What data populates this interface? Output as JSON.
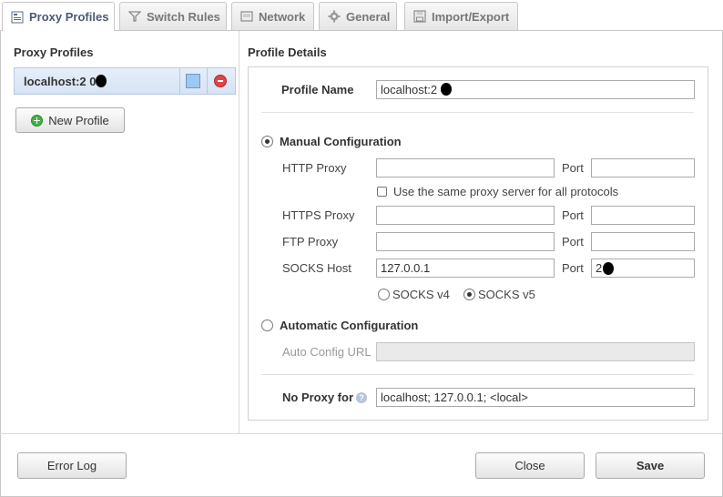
{
  "tabs": [
    {
      "label": "Proxy Profiles",
      "icon": "proxy-profiles-icon",
      "active": true
    },
    {
      "label": "Switch Rules",
      "icon": "filter-icon"
    },
    {
      "label": "Network",
      "icon": "network-icon"
    },
    {
      "label": "General",
      "icon": "gear-icon"
    },
    {
      "label": "Import/Export",
      "icon": "save-icon"
    }
  ],
  "sidebar": {
    "title": "Proxy Profiles",
    "profiles": [
      {
        "label": "localhost:2  0",
        "color": "#9cc9ef"
      }
    ],
    "new_profile_label": "New Profile"
  },
  "details": {
    "title": "Profile Details",
    "profile_name_label": "Profile Name",
    "profile_name_value": "localhost:2  0",
    "manual_config_label": "Manual Configuration",
    "http_proxy_label": "HTTP Proxy",
    "http_proxy_value": "",
    "http_port_label": "Port",
    "http_port_value": "",
    "same_proxy_label": "Use the same proxy server for all protocols",
    "https_proxy_label": "HTTPS Proxy",
    "https_proxy_value": "",
    "https_port_label": "Port",
    "https_port_value": "",
    "ftp_proxy_label": "FTP Proxy",
    "ftp_proxy_value": "",
    "ftp_port_label": "Port",
    "ftp_port_value": "",
    "socks_host_label": "SOCKS Host",
    "socks_host_value": "127.0.0.1",
    "socks_port_label": "Port",
    "socks_port_value": "2  0",
    "socks_v4_label": "SOCKS v4",
    "socks_v5_label": "SOCKS v5",
    "auto_config_label": "Automatic Configuration",
    "auto_config_url_label": "Auto Config URL",
    "auto_config_url_value": "",
    "no_proxy_label": "No Proxy for",
    "no_proxy_value": "localhost; 127.0.0.1; <local>"
  },
  "footer": {
    "error_log_label": "Error Log",
    "close_label": "Close",
    "save_label": "Save"
  }
}
